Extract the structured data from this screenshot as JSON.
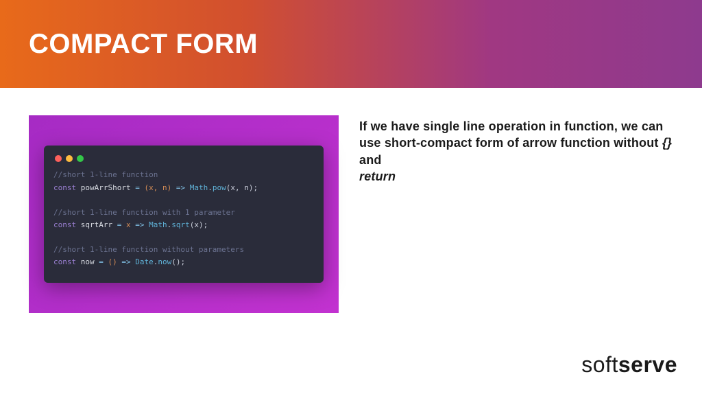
{
  "header": {
    "title": "COMPACT FORM"
  },
  "code": {
    "comment1": "//short 1-line function",
    "line1_kw": "const",
    "line1_id": "powArrShort",
    "line1_params": "(x, n)",
    "line1_arrow": "=>",
    "line1_obj": "Math",
    "line1_fn": "pow",
    "line1_args": "(x, n)",
    "comment2": "//short 1-line function with 1 parameter",
    "line2_kw": "const",
    "line2_id": "sqrtArr",
    "line2_param": "x",
    "line2_arrow": "=>",
    "line2_obj": "Math",
    "line2_fn": "sqrt",
    "line2_args": "(x)",
    "comment3": "//short 1-line function without parameters",
    "line3_kw": "const",
    "line3_id": "now",
    "line3_params": "()",
    "line3_arrow": "=>",
    "line3_obj": "Date",
    "line3_fn": "now",
    "line3_args": "()"
  },
  "explain": {
    "part1": "If we have single line operation in function, we can use short-compact form of arrow function without ",
    "braces": "{}",
    "part2": " and ",
    "ret": "return"
  },
  "logo": {
    "thin": "soft",
    "bold": "serve"
  }
}
